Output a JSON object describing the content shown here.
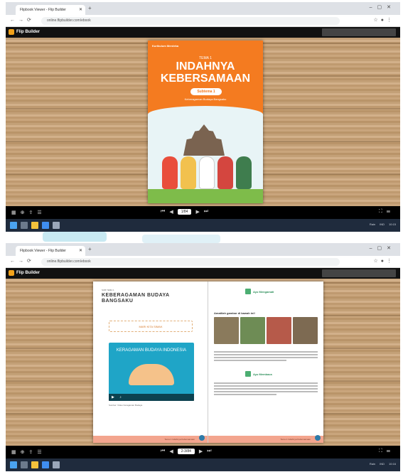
{
  "screens": [
    {
      "tab_title": "Flipbook Viewer - Flip Builder",
      "address": "online.flipbuilder.com/ebook",
      "app_name": "Flip Builder",
      "page_indicator": "1/84",
      "book": {
        "publisher": "Kurikulum Merdeka",
        "tema": "TEMA 1",
        "title_line1": "INDAHNYA",
        "title_line2": "KEBERSAMAAN",
        "subtema_badge": "Subtema 1",
        "subtitle": "Keberagaman Budaya Bangsaku"
      },
      "taskbar": {
        "weather": "Rain",
        "system": "IND",
        "time": "10:15"
      }
    },
    {
      "tab_title": "Flipbook Viewer - Flip Builder",
      "address": "online.flipbuilder.com/ebook",
      "app_name": "Flip Builder",
      "page_indicator": "2-3/84",
      "left_page": {
        "tag": "SUB TEMA 1",
        "heading": "KEBERAGAMAN BUDAYA BANGSAKU",
        "ribbon": "MARI KITA SIMAK",
        "video_title": "KERAGAMAN BUDAYA INDONESIA",
        "caption": "Sumber: Video Keragaman Budaya",
        "footer": "Tema 1 Indahnya Kebersamaan"
      },
      "right_page": {
        "section1": "Ayo Mengamati",
        "question": "Amatilah gambar di bawah ini!",
        "section2": "Ayo Membaca",
        "footer": "Tema 1 Indahnya Kebersamaan"
      },
      "taskbar": {
        "weather": "Rain",
        "system": "IND",
        "time": "10:16"
      }
    }
  ],
  "icons": [
    "thumbnails-icon",
    "zoom-icon",
    "share-icon",
    "first-page-icon",
    "prev-page-icon",
    "next-page-icon",
    "last-page-icon",
    "fullscreen-icon",
    "windows-start-icon",
    "search-icon",
    "folder-icon",
    "chrome-icon"
  ],
  "colors": {
    "cover_orange": "#f47b20",
    "footer_pink": "#f3a58e",
    "video_blue": "#1fa5c7",
    "taskbar": "#1f2b3d"
  }
}
